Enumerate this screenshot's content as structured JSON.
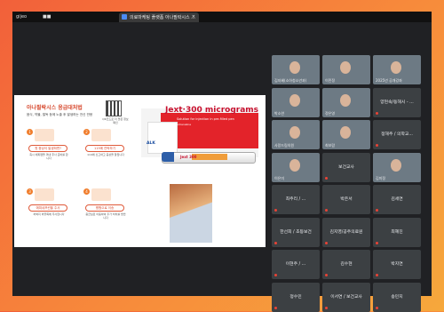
{
  "browser": {
    "left_tab": "gijeo",
    "left_tab2": "■■",
    "active_tab": "의료마케팅 플랫폼 아나필락시스 ...",
    "close_glyph": "×"
  },
  "slide": {
    "title": "아나필락시스 응급대처법",
    "subtitle": "음식, 약물, 벌독 등에 노출 후 발생하는 전신 반응",
    "qr_caption": "QR코드로 더 많은 정보 확인",
    "steps": [
      {
        "num": "1",
        "pill": "첫 증상이 발생하면?",
        "body": "즉시 에피펜을 꺼내 주사 준비를 합니다"
      },
      {
        "num": "2",
        "pill": "119에 연락하기",
        "body": "119에 신고하고 증상을 알립니다"
      },
      {
        "num": "3",
        "pill": "에피네프린을 주사",
        "body": "허벅지 바깥쪽에 주사합니다"
      },
      {
        "num": "4",
        "pill": "병원으로 이송",
        "body": "응급실로 이동하여 추가 처치를 받습니다"
      }
    ],
    "product": {
      "brand": "Jext·300 micrograms",
      "sub": "Solution for injection in pre-filled pen",
      "sub2": "Adrenaline",
      "maker": "ALK",
      "pen_label": "Jext 300"
    }
  },
  "participants": [
    {
      "name": "김지혜(소아청소년과)",
      "type": "video"
    },
    {
      "name": "이민정",
      "type": "video"
    },
    {
      "name": "2025년 공개강좌",
      "type": "video"
    },
    {
      "name": "박소연",
      "type": "video"
    },
    {
      "name": "정은영",
      "type": "video"
    },
    {
      "name": "양현숙/동해시 - ...",
      "type": "blank"
    },
    {
      "name": "사랑드림의원",
      "type": "video"
    },
    {
      "name": "최보람",
      "type": "video"
    },
    {
      "name": "정해주 / 의학교...",
      "type": "blank"
    },
    {
      "name": "이은미",
      "type": "video"
    },
    {
      "name": "보건교사",
      "type": "blank"
    },
    {
      "name": "김미정",
      "type": "video"
    },
    {
      "name": "최주리 / ...",
      "type": "blank"
    },
    {
      "name": "박은서",
      "type": "blank"
    },
    {
      "name": "김세연",
      "type": "blank"
    },
    {
      "name": "한선희 / 초등보건",
      "type": "blank"
    },
    {
      "name": "김지영/공주의료원",
      "type": "blank"
    },
    {
      "name": "최혜진",
      "type": "blank"
    },
    {
      "name": "이현주 / ...",
      "type": "blank"
    },
    {
      "name": "김수현",
      "type": "blank"
    },
    {
      "name": "박지연",
      "type": "blank"
    },
    {
      "name": "정수민",
      "type": "blank"
    },
    {
      "name": "이서연 / 보건교사",
      "type": "blank"
    },
    {
      "name": "송민지",
      "type": "blank"
    }
  ],
  "colors": {
    "background_from": "#f2603a",
    "background_to": "#f6a83c",
    "meet_bg": "#202124",
    "tile_bg": "#3c4043",
    "accent": "#d6462b"
  }
}
